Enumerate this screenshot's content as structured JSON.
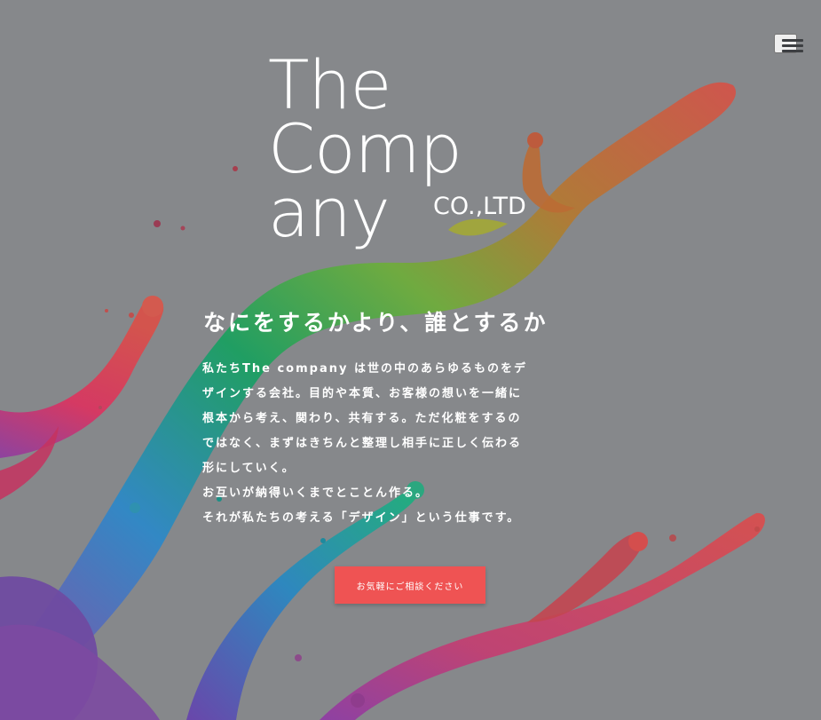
{
  "header": {
    "menu_icon": "hamburger-menu-icon"
  },
  "logo": {
    "line1": "The",
    "line2": "Comp",
    "line3": "any",
    "suffix": "CO.,LTD"
  },
  "hero": {
    "tagline": "なにをするかより、誰とするか",
    "description_lines": [
      "私たちThe company は世の中のあらゆるものをデ",
      "ザインする会社。目的や本質、お客様の想いを一緒に",
      "根本から考え、関わり、共有する。ただ化粧をするの",
      "ではなく、まずはきちんと整理し相手に正しく伝わる",
      "形にしていく。",
      "お互いが納得いくまでとことん作る。",
      "それが私たちの考える「デザイン」という仕事です。"
    ],
    "cta_label": "お気軽にご相談ください"
  },
  "colors": {
    "background": "#86888b",
    "accent": "#ef5353",
    "text": "#ffffff"
  }
}
